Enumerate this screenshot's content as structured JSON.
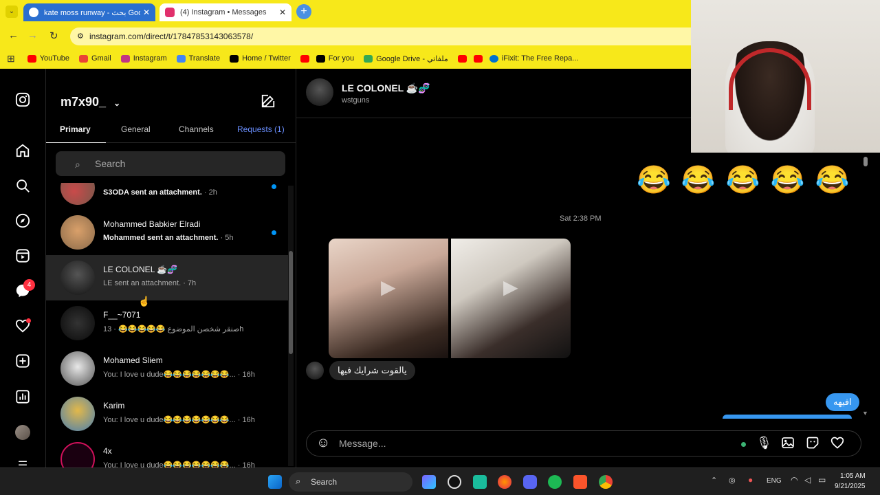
{
  "browser": {
    "tabs": [
      {
        "title": "kate moss runway - بحث Google",
        "active": false
      },
      {
        "title": "(4) Instagram • Messages",
        "active": true
      }
    ],
    "url": "instagram.com/direct/t/17847853143063578/",
    "bookmarks": [
      "YouTube",
      "Gmail",
      "Instagram",
      "Translate",
      "Home / Twitter",
      "For you",
      "Google Drive - ملفاتي",
      "iFixit: The Free Repa..."
    ]
  },
  "rail": {
    "notification_badge": "4"
  },
  "inbox": {
    "username": "m7x90_",
    "tabs": [
      "Primary",
      "General",
      "Channels",
      "Requests (1)"
    ],
    "search_placeholder": "Search",
    "threads": [
      {
        "name": "",
        "preview": "S3ODA sent an attachment.",
        "time": "· 2h",
        "unread": true
      },
      {
        "name": "Mohammed Babkier Elradi",
        "preview": "Mohammed sent an attachment.",
        "time": "· 5h",
        "unread": true
      },
      {
        "name": "LE COLONEL ☕🧬",
        "preview": "LE sent an attachment.",
        "time": "· 7h",
        "unread": false
      },
      {
        "name": "F__~7071",
        "preview": "صنقر شخصن الموضوع 😂😂😂😂😂",
        "time": "· 13h",
        "unread": false
      },
      {
        "name": "Mohamed Sliem",
        "preview": "You: I love u dude😂😂😂😂😂😂😂...",
        "time": "· 16h",
        "unread": false
      },
      {
        "name": "Karim",
        "preview": "You: I love u dude😂😂😂😂😂😂😂...",
        "time": "· 16h",
        "unread": false
      },
      {
        "name": "4x",
        "preview": "You: I love u dude😂😂😂😂😂😂😂...",
        "time": "· 16h",
        "unread": false
      }
    ]
  },
  "thread": {
    "name": "LE COLONEL ☕🧬",
    "handle": "wstguns",
    "emoji_row": "😂 😂 😂 😂 😂",
    "date_separator": "Sat 2:38 PM",
    "incoming_text": "يالقوت شرايك فيها",
    "outgoing_text": "افيهه",
    "message_placeholder": "Message..."
  },
  "taskbar": {
    "search_label": "Search",
    "lang": "ENG",
    "time": "1:05 AM",
    "date": "9/21/2025"
  },
  "colors": {
    "accent": "#0095f6",
    "chrome": "#f7e81a",
    "bubble_out": "#3797f0"
  }
}
